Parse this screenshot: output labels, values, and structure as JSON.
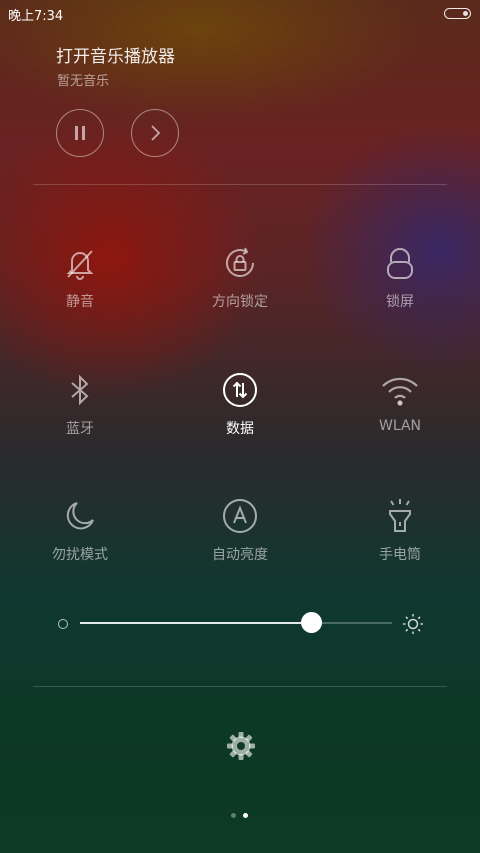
{
  "status_bar": {
    "time": "晚上7:34",
    "battery_level": 0.2
  },
  "music": {
    "title": "打开音乐播放器",
    "subtitle": "暂无音乐",
    "buttons": [
      "pause-icon",
      "chevron-right-icon"
    ]
  },
  "toggles": [
    {
      "label": "静音",
      "icon": "bell-off-icon",
      "active": false
    },
    {
      "label": "方向锁定",
      "icon": "rotation-lock-icon",
      "active": false
    },
    {
      "label": "锁屏",
      "icon": "lock-icon",
      "active": false
    },
    {
      "label": "蓝牙",
      "icon": "bluetooth-icon",
      "active": false
    },
    {
      "label": "数据",
      "icon": "mobile-data-icon",
      "active": true
    },
    {
      "label": "WLAN",
      "icon": "wifi-icon",
      "active": false
    },
    {
      "label": "勿扰模式",
      "icon": "moon-icon",
      "active": false
    },
    {
      "label": "自动亮度",
      "icon": "auto-brightness-icon",
      "active": false
    },
    {
      "label": "手电筒",
      "icon": "flashlight-icon",
      "active": false
    }
  ],
  "brightness": {
    "level": 0.74,
    "min_icon": "brightness-low-icon",
    "max_icon": "brightness-high-icon"
  },
  "settings_icon": "gear-icon",
  "pager": {
    "count": 2,
    "active_index": 1
  }
}
